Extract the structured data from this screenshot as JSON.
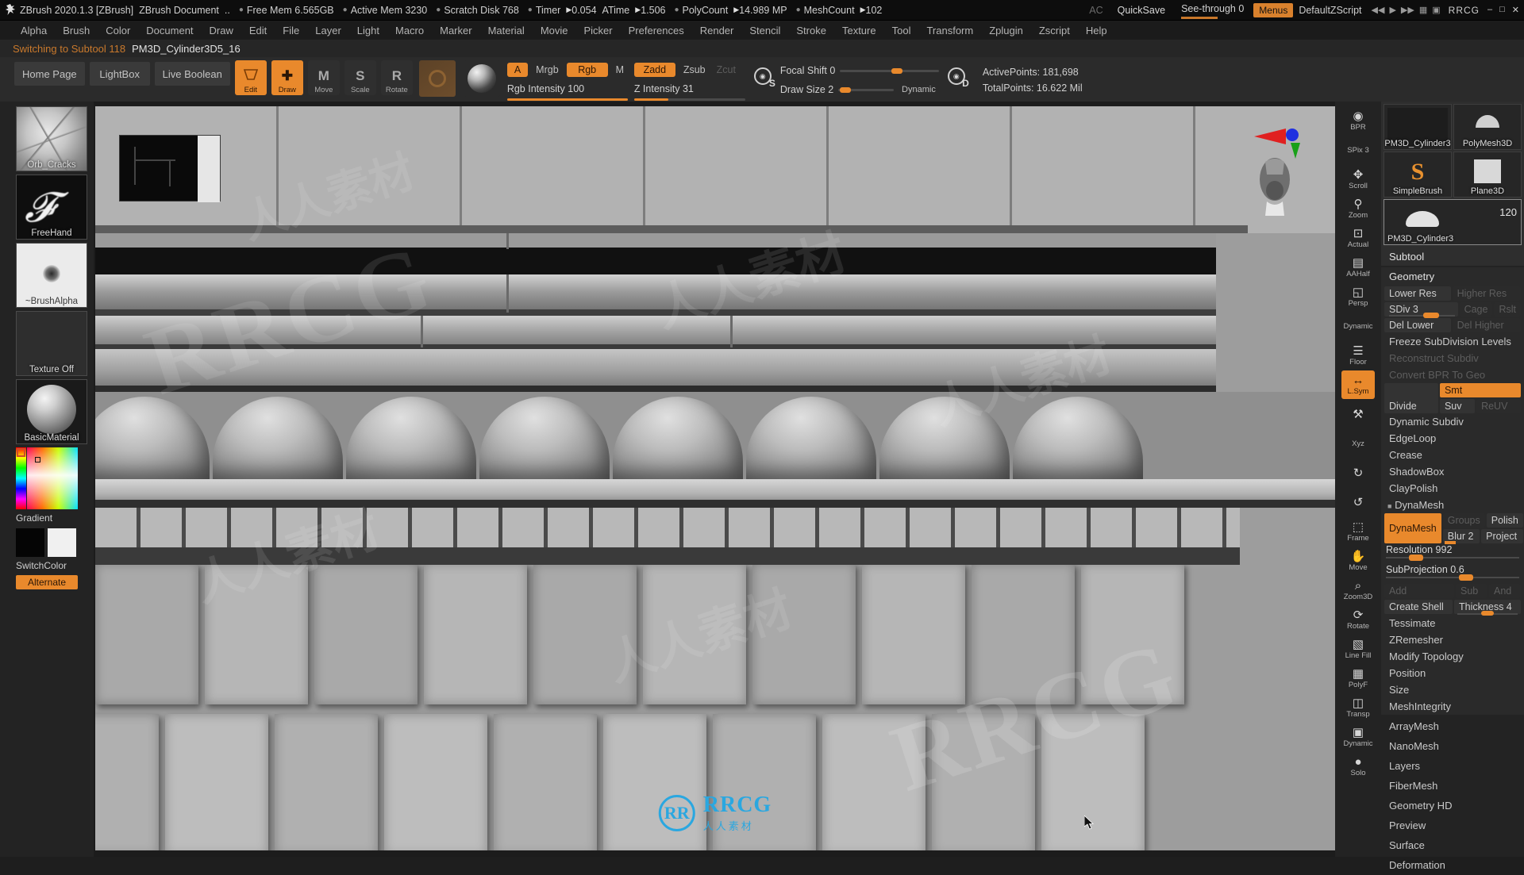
{
  "titlebar": {
    "app": "ZBrush 2020.1.3 [ZBrush]",
    "document": "ZBrush Document",
    "ellipsis": "..",
    "free_mem": "Free Mem 6.565GB",
    "active_mem": "Active Mem 3230",
    "scratch_disk": "Scratch Disk 768",
    "timer_label": "Timer",
    "timer_value": "0.054",
    "atime_label": "ATime",
    "atime_value": "1.506",
    "polycount_label": "PolyCount",
    "polycount_value": "14.989 MP",
    "meshcount_label": "MeshCount",
    "meshcount_value": "102",
    "ac": "AC",
    "quicksave": "QuickSave",
    "see_through": "See-through  0",
    "menus": "Menus",
    "default_zscript": "DefaultZScript",
    "brand": "RRCG",
    "win_min": "–",
    "win_max": "□",
    "win_close": "✕"
  },
  "menubar": {
    "items": [
      "Alpha",
      "Brush",
      "Color",
      "Document",
      "Draw",
      "Edit",
      "File",
      "Layer",
      "Light",
      "Macro",
      "Marker",
      "Material",
      "Movie",
      "Picker",
      "Preferences",
      "Render",
      "Stencil",
      "Stroke",
      "Texture",
      "Tool",
      "Transform",
      "Zplugin",
      "Zscript",
      "Help"
    ]
  },
  "statusline": {
    "message": "Switching to Subtool 118",
    "subtool": "PM3D_Cylinder3D5_16"
  },
  "toolbar": {
    "home_page": "Home Page",
    "lightbox": "LightBox",
    "live_boolean": "Live Boolean",
    "edit": "Edit",
    "draw": "Draw",
    "move": "Move",
    "scale": "Scale",
    "rotate": "Rotate",
    "move_glyph": "M",
    "scale_glyph": "S",
    "rotate_glyph": "R",
    "a_btn": "A",
    "mrgb": "Mrgb",
    "rgb": "Rgb",
    "m_btn": "M",
    "zadd": "Zadd",
    "zsub": "Zsub",
    "zcut": "Zcut",
    "rgb_intensity": "Rgb Intensity 100",
    "z_intensity": "Z Intensity 31",
    "focal_shift": "Focal Shift 0",
    "draw_size": "Draw Size 2",
    "dynamic": "Dynamic",
    "s_tag": "S",
    "d_tag": "D",
    "active_points": "ActivePoints: 181,698",
    "total_points": "TotalPoints: 16.622 Mil"
  },
  "left_shelf": {
    "items": [
      {
        "name": "Orb_Cracks",
        "kind": "brush"
      },
      {
        "name": "FreeHand",
        "kind": "stroke"
      },
      {
        "name": "~BrushAlpha",
        "kind": "alpha"
      },
      {
        "name": "Texture Off",
        "kind": "texture"
      },
      {
        "name": "BasicMaterial",
        "kind": "material"
      }
    ],
    "gradient_label": "Gradient",
    "switchcolor_label": "SwitchColor",
    "alternate_label": "Alternate"
  },
  "right_strip": {
    "items": [
      {
        "label": "BPR",
        "glyph": "◉"
      },
      {
        "label": "SPix 3",
        "glyph": ""
      },
      {
        "label": "Scroll",
        "glyph": "✥"
      },
      {
        "label": "Zoom",
        "glyph": "⚲"
      },
      {
        "label": "Actual",
        "glyph": "⊡"
      },
      {
        "label": "AAHalf",
        "glyph": "▤"
      },
      {
        "label": "Persp",
        "glyph": "◱"
      },
      {
        "label": "Dynamic",
        "glyph": ""
      },
      {
        "label": "Floor",
        "glyph": "☰"
      },
      {
        "label": "L.Sym",
        "glyph": "↔"
      },
      {
        "label": "",
        "glyph": "⚒"
      },
      {
        "label": "Xyz",
        "glyph": ""
      },
      {
        "label": "",
        "glyph": "↻"
      },
      {
        "label": "",
        "glyph": "↺"
      },
      {
        "label": "Frame",
        "glyph": "⬚"
      },
      {
        "label": "Move",
        "glyph": "✋"
      },
      {
        "label": "Zoom3D",
        "glyph": "⌕"
      },
      {
        "label": "Rotate",
        "glyph": "⟳"
      },
      {
        "label": "Line Fill",
        "glyph": "▧"
      },
      {
        "label": "PolyF",
        "glyph": "▦"
      },
      {
        "label": "Transp",
        "glyph": "◫"
      },
      {
        "label": "Dynamic",
        "glyph": "▣"
      },
      {
        "label": "Solo",
        "glyph": "●"
      }
    ]
  },
  "right_panel": {
    "tools": [
      {
        "name": "PM3D_Cylinder3",
        "num": ""
      },
      {
        "name": "PolyMesh3D",
        "num": ""
      },
      {
        "name": "SimpleBrush",
        "num": ""
      },
      {
        "name": "Plane3D",
        "num": ""
      },
      {
        "name": "PM3D_Cylinder3",
        "num": "120"
      }
    ],
    "subtool_header": "Subtool",
    "geometry_header": "Geometry",
    "lower_res": "Lower Res",
    "higher_res": "Higher Res",
    "sdiv": "SDiv 3",
    "cage": "Cage",
    "rsln": "Rslt",
    "del_lower": "Del Lower",
    "del_higher": "Del Higher",
    "freeze_subdivision": "Freeze SubDivision Levels",
    "reconstruct_subdiv": "Reconstruct Subdiv",
    "convert_bpr": "Convert BPR To Geo",
    "divide": "Divide",
    "smt": "Smt",
    "suv": "Suv",
    "reuv": "ReUV",
    "dynamic_subdiv": "Dynamic Subdiv",
    "edgeloop": "EdgeLoop",
    "crease": "Crease",
    "shadowbox": "ShadowBox",
    "claypolish": "ClayPolish",
    "dynamesh_header": "DynaMesh",
    "dynamesh_btn": "DynaMesh",
    "groups": "Groups",
    "polish": "Polish",
    "blur": "Blur 2",
    "project": "Project",
    "resolution": "Resolution 992",
    "subprojection": "SubProjection 0.6",
    "add": "Add",
    "sub": "Sub",
    "and": "And",
    "create_shell": "Create Shell",
    "thickness": "Thickness 4",
    "tessimate": "Tessimate",
    "zremesher": "ZRemesher",
    "modify_topology": "Modify Topology",
    "position": "Position",
    "size": "Size",
    "mesh_integrity": "MeshIntegrity",
    "list": [
      "ArrayMesh",
      "NanoMesh",
      "Layers",
      "FiberMesh",
      "Geometry HD",
      "Preview",
      "Surface",
      "Deformation"
    ]
  },
  "watermark": {
    "brand_letters": "RR",
    "brand_big": "RRCG",
    "brand_small": "人人素材",
    "tile": "人人素材"
  },
  "colors": {
    "accent": "#e9892c",
    "panel_bg": "#232323",
    "canvas_bg": "#9d9d9d",
    "title_bg": "#0d0d0d"
  }
}
